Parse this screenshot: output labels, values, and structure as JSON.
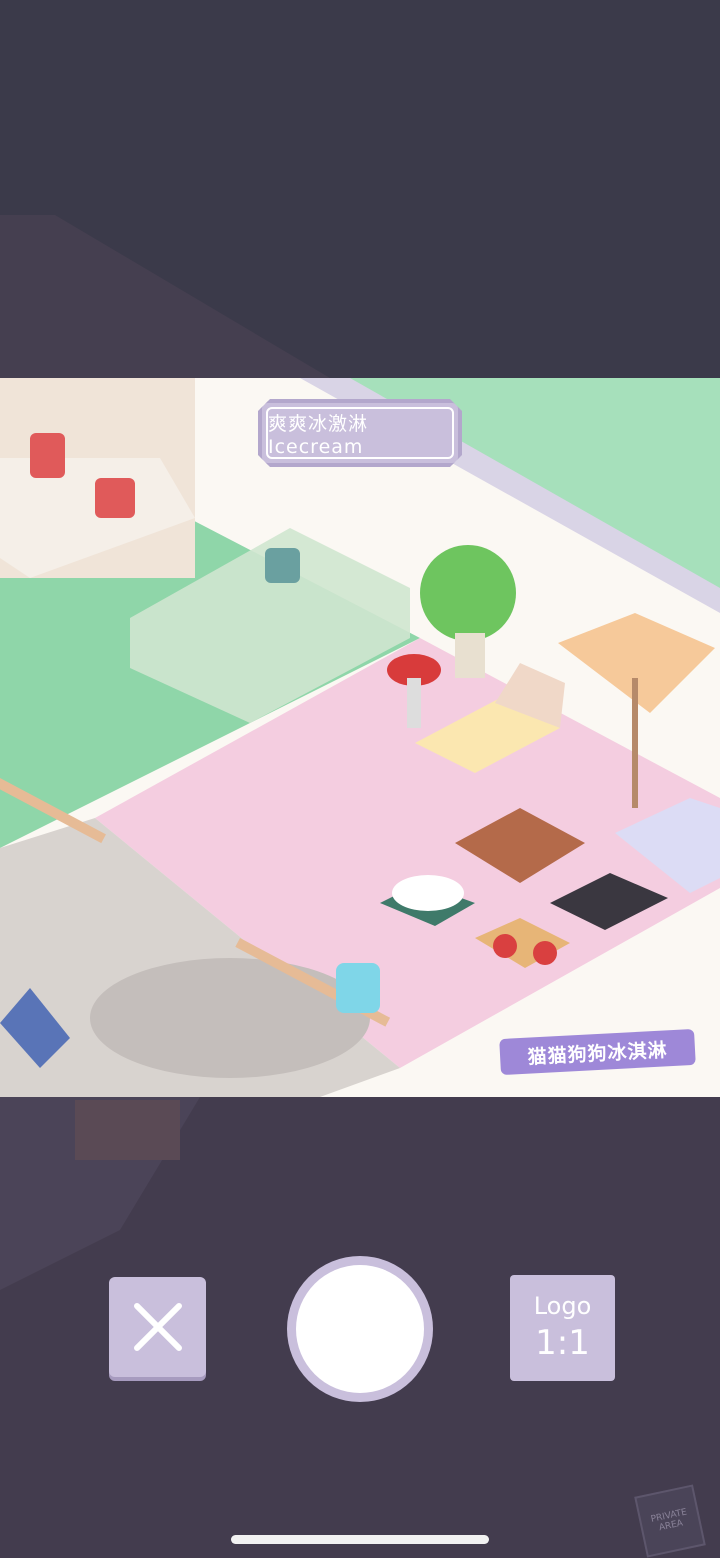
{
  "shop_sign": {
    "text": "爽爽冰激淋 Icecream"
  },
  "logo_banner": {
    "text": "猫猫狗狗冰淇淋"
  },
  "controls": {
    "close_icon": "close-x-icon",
    "shutter": "shutter-button",
    "ratio_logo_label": "Logo",
    "ratio_value": "1:1"
  },
  "background": {
    "private_sign": "PRIVATE AREA"
  },
  "colors": {
    "overlay": "#3b3a4a",
    "button": "#c9bfdc",
    "floor_pink": "#f3cfe0",
    "grass_green": "#9fdcb0"
  }
}
